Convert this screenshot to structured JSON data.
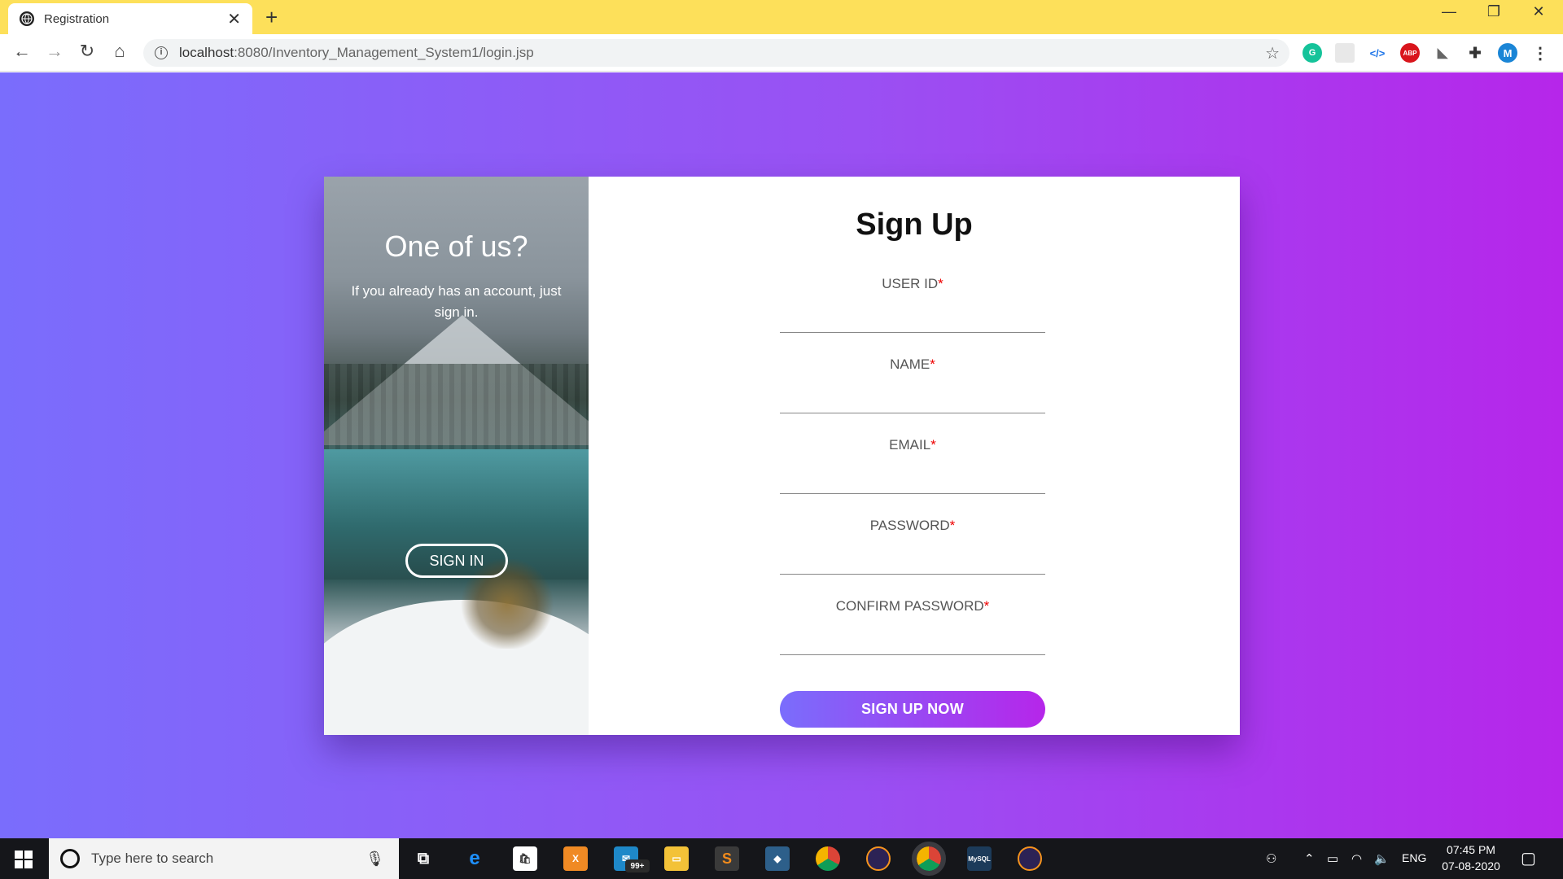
{
  "browser": {
    "tab_title": "Registration",
    "url_host": "localhost",
    "url_rest": ":8080/Inventory_Management_System1/login.jsp"
  },
  "hero": {
    "heading": "One of us?",
    "text": "If you already has an account, just sign in.",
    "signin_label": "SIGN IN"
  },
  "form": {
    "title": "Sign Up",
    "fields": [
      {
        "label": "USER ID",
        "required": "*"
      },
      {
        "label": "NAME",
        "required": "*"
      },
      {
        "label": "EMAIL",
        "required": "*"
      },
      {
        "label": "PASSWORD",
        "required": "*"
      },
      {
        "label": "CONFIRM PASSWORD",
        "required": "*"
      }
    ],
    "submit_label": "SIGN UP NOW"
  },
  "taskbar": {
    "search_placeholder": "Type here to search",
    "mail_badge": "99+",
    "language": "ENG",
    "time": "07:45 PM",
    "date": "07-08-2020"
  },
  "colors": {
    "gradient_start": "#7a6dfc",
    "gradient_end": "#b626ea",
    "tabbar": "#fde05a"
  }
}
